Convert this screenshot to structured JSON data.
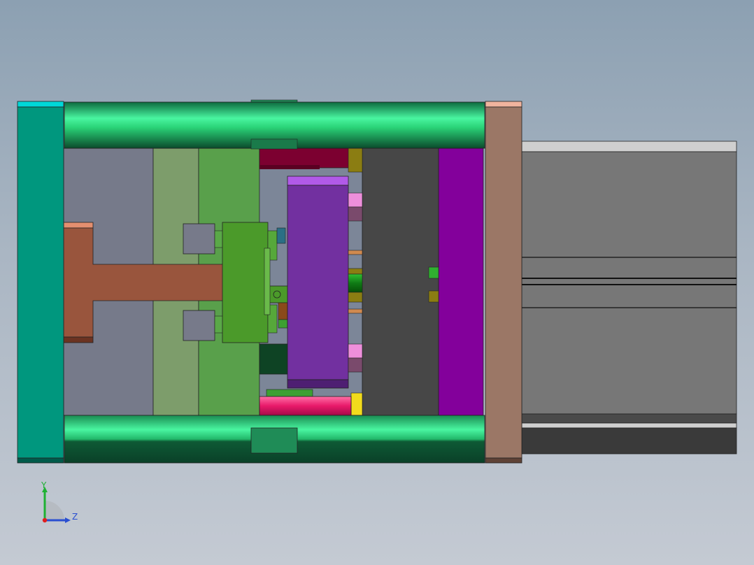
{
  "axes": {
    "y_label": "Y",
    "z_label": "Z"
  },
  "colors": {
    "background_top": "#8ca0b2",
    "background_bottom": "#c4cad3",
    "clamp_plate_left": "#00977e",
    "clamp_plate_left_cap": "#00d8d8",
    "guide_rail": "#2ad377",
    "guide_rail_dark": "#0d5a35",
    "rail_tab": "#1f8c57",
    "clamp_plate_right": "#9b7766",
    "clamp_plate_right_cap": "#f0b49e",
    "cylinder_body": "#777777",
    "cylinder_cap": "#cfcfcf",
    "cylinder_base": "#3a3a3a",
    "spacer_grey": "#767a8a",
    "plate_olive": "#7d9d6b",
    "plate_green": "#59a04b",
    "sprue_brown": "#99553d",
    "sprue_cap": "#e38f70",
    "slider_block": "#4b9a2a",
    "boss_grey": "#777a8a",
    "cavity_purple": "#7230a0",
    "cavity_purple_top": "#b15ae8",
    "core_dark": "#474747",
    "plate_magenta": "#83009b",
    "maroon_block": "#7c0030",
    "pink_pin": "#e8196a",
    "pink_light": "#ee8fdb",
    "yellow_pin": "#f2db1c",
    "olive_pin": "#8b7d12",
    "dark_green_block": "#0e4324",
    "triad_y": "#1fb133",
    "triad_z": "#2a4fd1",
    "triad_origin": "#e01e1e"
  }
}
